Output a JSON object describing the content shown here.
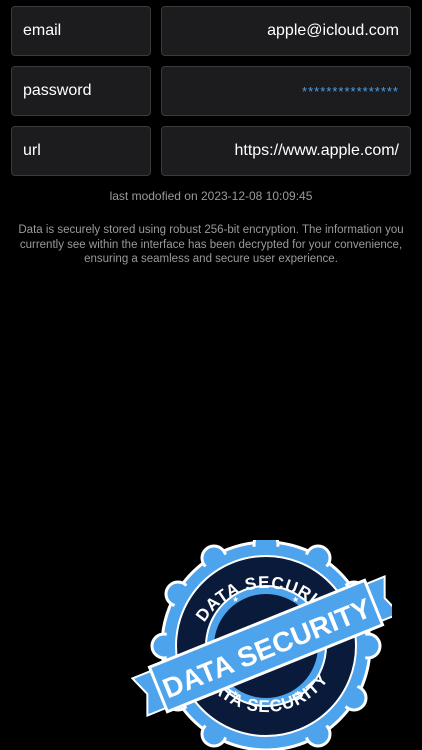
{
  "fields": {
    "email": {
      "label": "email",
      "value": "apple@icloud.com"
    },
    "password": {
      "label": "password",
      "value": "****************"
    },
    "url": {
      "label": "url",
      "value": "https://www.apple.com/"
    }
  },
  "modified_text": "last modofied on 2023-12-08 10:09:45",
  "security_note": "Data is securely stored using robust 256-bit encryption. The information you currently see within the interface has been decrypted for your convenience, ensuring a seamless and secure user experience.",
  "stamp": {
    "top_text": "DATA SECURITY",
    "banner_text": "DATA SECURITY",
    "bottom_text": "DATA SECURITY",
    "colors": {
      "light": "#4da3ec",
      "dark": "#0a1a3a",
      "outline": "#ffffff"
    }
  },
  "colors": {
    "background": "#000000",
    "field_bg": "#1c1c1e",
    "field_border": "#3a3a3c",
    "secret": "#4e9fe8",
    "muted_text": "#9a9a9e"
  }
}
